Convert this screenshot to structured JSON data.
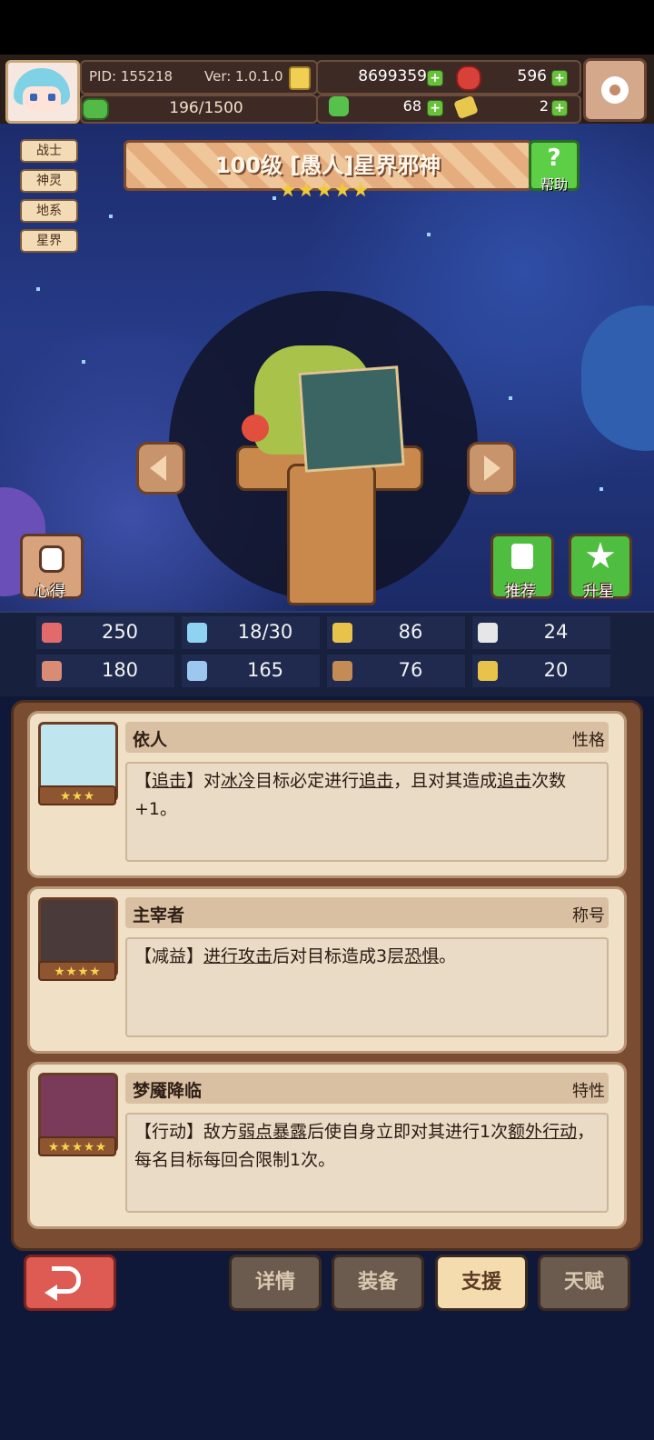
{
  "header": {
    "pid": "PID: 155218",
    "version": "Ver: 1.0.1.0",
    "gold": "8699359",
    "gems": "596",
    "stamina": "196/1500",
    "clover": "68",
    "keys": "2",
    "plus_symbol": "+"
  },
  "tags": [
    "战士",
    "神灵",
    "地系",
    "星界"
  ],
  "hero": {
    "title": "100级 [愚人]星界邪神",
    "stars": 5,
    "help_label": "帮助",
    "xinde_label": "心得",
    "tuijian_label": "推荐",
    "shengxing_label": "升星"
  },
  "stats": [
    {
      "icon": "heart-icon",
      "value": "250"
    },
    {
      "icon": "drop-icon",
      "value": "18/30"
    },
    {
      "icon": "shield-icon",
      "value": "86"
    },
    {
      "icon": "wing-icon",
      "value": "24"
    },
    {
      "icon": "fist-icon",
      "value": "180"
    },
    {
      "icon": "book-icon",
      "value": "165"
    },
    {
      "icon": "boot-icon",
      "value": "76"
    },
    {
      "icon": "horseshoe-icon",
      "value": "20"
    }
  ],
  "cards": [
    {
      "name": "依人",
      "type": "性格",
      "stars": 3,
      "desc_html": "【<span class='kw'>追击</span>】对<span class='kw'>冰冷</span>目标必定进行<span class='kw'>追击</span>，且对其造成<span class='kw'>追击</span>次数+1。"
    },
    {
      "name": "主宰者",
      "type": "称号",
      "stars": 4,
      "desc_html": "【减益】<span class='kw'>进行攻击</span>后对目标造成3层<span class='kw'>恐惧</span>。"
    },
    {
      "name": "梦魇降临",
      "type": "特性",
      "stars": 5,
      "desc_html": "【行动】敌方<span class='kw'>弱点暴露</span>后使自身立即对其进行1次<span class='kw'>额外行动</span>，每名目标每回合限制1次。"
    }
  ],
  "nav": {
    "details": "详情",
    "equipment": "装备",
    "support": "支援",
    "talent": "天赋",
    "active": "support"
  },
  "colors": {
    "accent_green": "#4fbd40",
    "back_red": "#dd5b53",
    "panel_brown": "#7a4d33"
  }
}
